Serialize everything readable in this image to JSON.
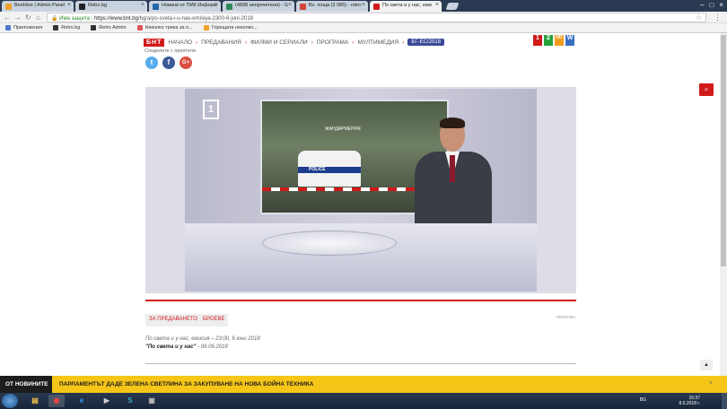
{
  "browser": {
    "tabs": [
      {
        "title": "BeeHive | Admin Panel",
        "icon_color": "#f0a02a",
        "active": false
      },
      {
        "title": "Retro.bg",
        "icon_color": "#222222",
        "active": false
      },
      {
        "title": "Новини от ПИК Информ",
        "icon_color": "#2266aa",
        "active": false
      },
      {
        "title": "(4898 непрочетени) - G",
        "icon_color": "#2e8b57",
        "active": false
      },
      {
        "title": "Вх. поща (3 085) - retro",
        "icon_color": "#d44638",
        "active": false
      },
      {
        "title": "По света и у нас, еми",
        "icon_color": "#d01a1a",
        "active": true
      }
    ],
    "url_secure": "Има защита",
    "url_host": "https://www.bnt.bg",
    "url_path": "/bg/a/po-sveta-i-u-nas-emisiya-2300-6-juni-2018",
    "bookmarks": [
      "Приложения",
      "Retro.bg",
      "Retro Admin",
      "Няколко трика за о...",
      "Горещата неколко..."
    ]
  },
  "site": {
    "logo": "БНТ",
    "nav": [
      "НАЧАЛО",
      "ПРЕДАВАНИЯ",
      "ФИЛМИ И СЕРИАЛИ",
      "ПРОГРАМА",
      "МУЛТИМЕДИЯ"
    ],
    "eu_button": "БГ-ЕС/2018",
    "channels": [
      {
        "label": "1",
        "color": "#d01a1a"
      },
      {
        "label": "2",
        "color": "#27a13a"
      },
      {
        "label": "HD",
        "color": "#f29c1f"
      },
      {
        "label": "W",
        "color": "#3b6fc4"
      }
    ],
    "share_label": "Споделете с приятели",
    "social": [
      {
        "name": "twitter",
        "glyph": "t",
        "color": "#55acee"
      },
      {
        "name": "facebook",
        "glyph": "f",
        "color": "#3b5998"
      },
      {
        "name": "google-plus",
        "glyph": "G+",
        "color": "#dc4e41"
      }
    ],
    "search_glyph": "⌕"
  },
  "video": {
    "channel_bug": "1",
    "screen_text": "ЖАНДАРМЕРИЯ",
    "car_text": "POLICE"
  },
  "article": {
    "ad_label": "РЕКЛАМА",
    "tags": [
      "ЗА ПРЕДАВАНЕТО",
      "БРОЕВЕ"
    ],
    "description": "По света и у нас, емисия – 23:00, 6 юни 2018",
    "show_name": "\"По света и у нас\"",
    "show_date": " - 06.06.2018",
    "scroll_top": "▲"
  },
  "ticker": {
    "label": "ОТ НОВИНИТЕ",
    "text": "ПАРЛАМЕНТЪТ ДАДЕ ЗЕЛЕНА СВЕТЛИНА ЗА ЗАКУПУВАНЕ НА НОВА БОЙНА ТЕХНИКА",
    "close": "×"
  },
  "taskbar": {
    "lang": "BG",
    "time": "15:37",
    "date": "8.6.2018 г."
  }
}
